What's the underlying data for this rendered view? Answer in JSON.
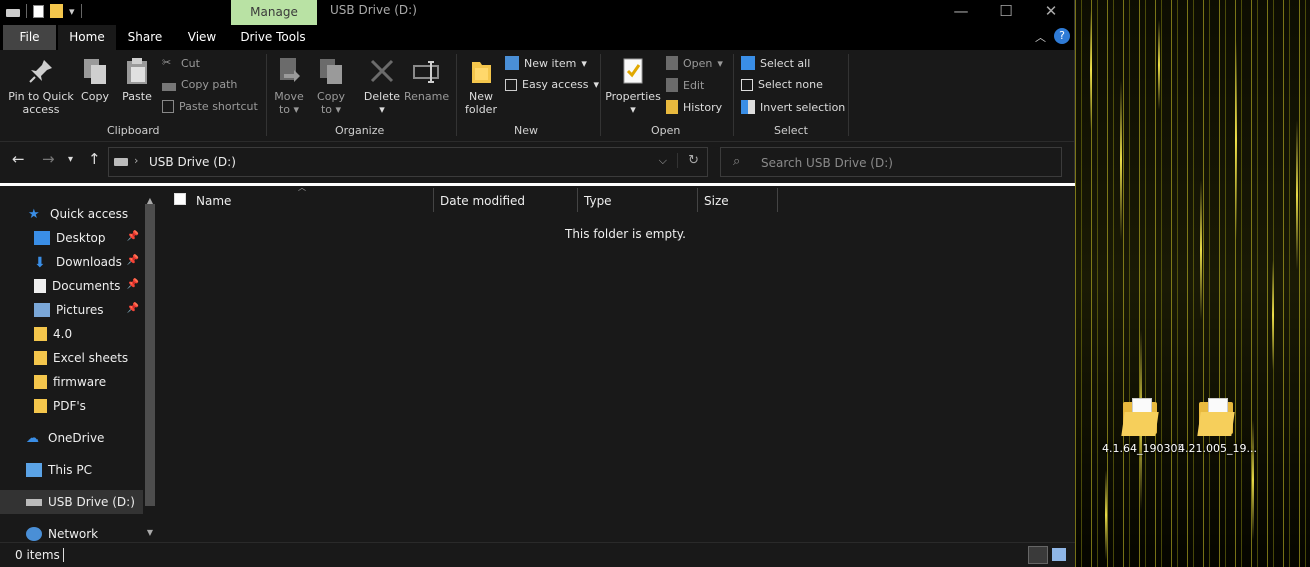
{
  "window": {
    "title": "USB Drive (D:)",
    "context_tab": "Manage",
    "controls": {
      "minimize": "—",
      "maximize": "☐",
      "close": "✕"
    }
  },
  "tabs": {
    "file": "File",
    "home": "Home",
    "share": "Share",
    "view": "View",
    "drive_tools": "Drive Tools",
    "help": "?"
  },
  "ribbon": {
    "clipboard": {
      "label": "Clipboard",
      "pin_line1": "Pin to Quick",
      "pin_line2": "access",
      "copy": "Copy",
      "paste": "Paste",
      "cut": "Cut",
      "copy_path": "Copy path",
      "paste_shortcut": "Paste shortcut"
    },
    "organize": {
      "label": "Organize",
      "move_line1": "Move",
      "move_line2": "to",
      "copy_line1": "Copy",
      "copy_line2": "to",
      "delete": "Delete",
      "rename": "Rename"
    },
    "new": {
      "label": "New",
      "folder_line1": "New",
      "folder_line2": "folder",
      "new_item": "New item",
      "easy_access": "Easy access"
    },
    "open": {
      "label": "Open",
      "properties": "Properties",
      "open": "Open",
      "edit": "Edit",
      "history": "History"
    },
    "select": {
      "label": "Select",
      "select_all": "Select all",
      "select_none": "Select none",
      "invert": "Invert selection"
    }
  },
  "address": {
    "path": "USB Drive (D:)",
    "search_placeholder": "Search USB Drive (D:)"
  },
  "sidebar": {
    "items": [
      {
        "label": "Quick access",
        "pinned": false
      },
      {
        "label": "Desktop",
        "pinned": true
      },
      {
        "label": "Downloads",
        "pinned": true
      },
      {
        "label": "Documents",
        "pinned": true
      },
      {
        "label": "Pictures",
        "pinned": true
      },
      {
        "label": "4.0",
        "pinned": false
      },
      {
        "label": "Excel sheets",
        "pinned": false
      },
      {
        "label": "firmware",
        "pinned": false
      },
      {
        "label": "PDF's",
        "pinned": false
      },
      {
        "label": "OneDrive",
        "pinned": false
      },
      {
        "label": "This PC",
        "pinned": false
      },
      {
        "label": "USB Drive (D:)",
        "pinned": false,
        "selected": true
      },
      {
        "label": "Network",
        "pinned": false
      }
    ]
  },
  "columns": {
    "name": "Name",
    "date_modified": "Date modified",
    "type": "Type",
    "size": "Size"
  },
  "content": {
    "empty_message": "This folder is empty."
  },
  "status": {
    "item_count": "0 items"
  },
  "desktop_icons": [
    {
      "label": "4.1.64_190305"
    },
    {
      "label": "4.21.005_19..."
    }
  ],
  "colors": {
    "context_tab": "#b9e2a4",
    "background": "#191919",
    "accent_blue": "#2f7bd6",
    "folder": "#f4c64c"
  }
}
